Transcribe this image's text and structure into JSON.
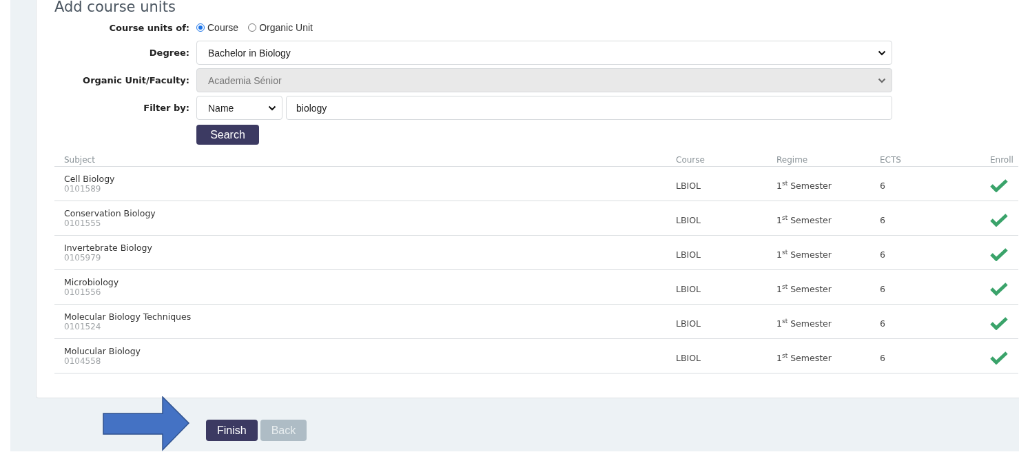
{
  "title": "Add course units",
  "form": {
    "course_units_of": {
      "label": "Course units of:",
      "options": [
        {
          "label": "Course",
          "selected": true
        },
        {
          "label": "Organic Unit",
          "selected": false
        }
      ]
    },
    "degree": {
      "label": "Degree:",
      "value": "Bachelor in Biology",
      "disabled": false
    },
    "organic_unit": {
      "label": "Organic Unit/Faculty:",
      "value": "Academia Sénior",
      "disabled": true
    },
    "filter": {
      "label": "Filter by:",
      "field": "Name",
      "value": "biology"
    },
    "search_button": "Search"
  },
  "table": {
    "columns": [
      "Subject",
      "Course",
      "Regime",
      "ECTS",
      "Enroll"
    ],
    "rows": [
      {
        "subject": "Cell Biology",
        "code": "0101589",
        "course": "LBIOL",
        "regime": "1$^{st}$ Semester",
        "ects": "6"
      },
      {
        "subject": "Conservation Biology",
        "code": "0101555",
        "course": "LBIOL",
        "regime": "1$^{st}$ Semester",
        "ects": "6"
      },
      {
        "subject": "Invertebrate Biology",
        "code": "0105979",
        "course": "LBIOL",
        "regime": "1$^{st}$ Semester",
        "ects": "6"
      },
      {
        "subject": "Microbiology",
        "code": "0101556",
        "course": "LBIOL",
        "regime": "1$^{st}$ Semester",
        "ects": "6"
      },
      {
        "subject": "Molecular Biology Techniques",
        "code": "0101524",
        "course": "LBIOL",
        "regime": "1$^{st}$ Semester",
        "ects": "6"
      },
      {
        "subject": "Molucular Biology",
        "code": "0104558",
        "course": "LBIOL",
        "regime": "1$^{st}$ Semester",
        "ects": "6"
      }
    ]
  },
  "buttons": [
    {
      "label": "Finish",
      "disabled": false
    },
    {
      "label": "Back",
      "disabled": true
    }
  ]
}
